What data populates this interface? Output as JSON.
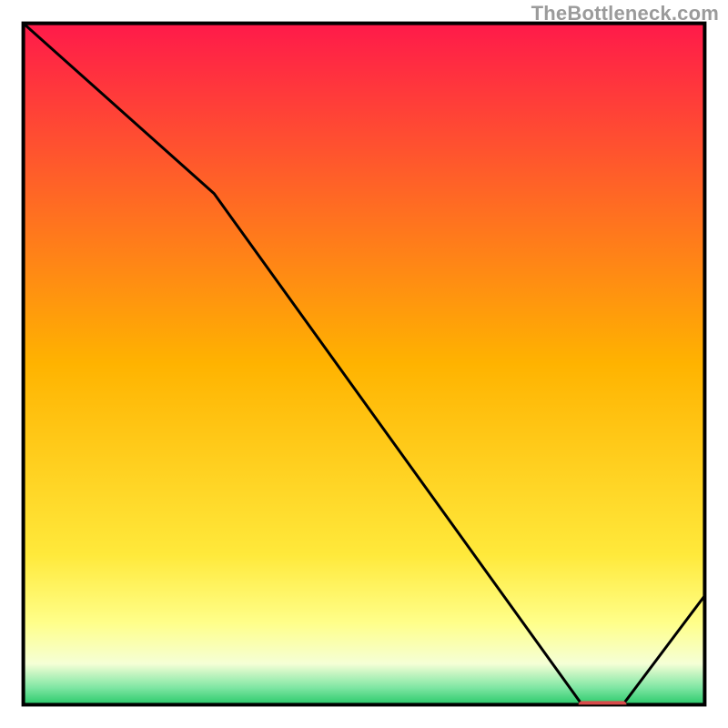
{
  "watermark": "TheBottleneck.com",
  "chart_data": {
    "type": "line",
    "title": "",
    "xlabel": "",
    "ylabel": "",
    "ylim": [
      0,
      100
    ],
    "xlim": [
      0,
      100
    ],
    "x": [
      0,
      28,
      82,
      88,
      100
    ],
    "values": [
      100,
      75,
      0,
      0,
      16
    ],
    "marker": {
      "x_range": [
        82,
        88
      ],
      "y": 0,
      "color": "#d94a4a"
    },
    "gradient_stops": [
      {
        "offset": 0.0,
        "color": "#ff1a4a"
      },
      {
        "offset": 0.5,
        "color": "#ffb300"
      },
      {
        "offset": 0.78,
        "color": "#ffe93b"
      },
      {
        "offset": 0.88,
        "color": "#ffff8a"
      },
      {
        "offset": 0.94,
        "color": "#f5ffd6"
      },
      {
        "offset": 0.975,
        "color": "#7fe6a3"
      },
      {
        "offset": 1.0,
        "color": "#29c96a"
      }
    ],
    "frame": {
      "x": 3.2,
      "y": 3.2,
      "w": 93.6,
      "h": 93.6
    }
  }
}
